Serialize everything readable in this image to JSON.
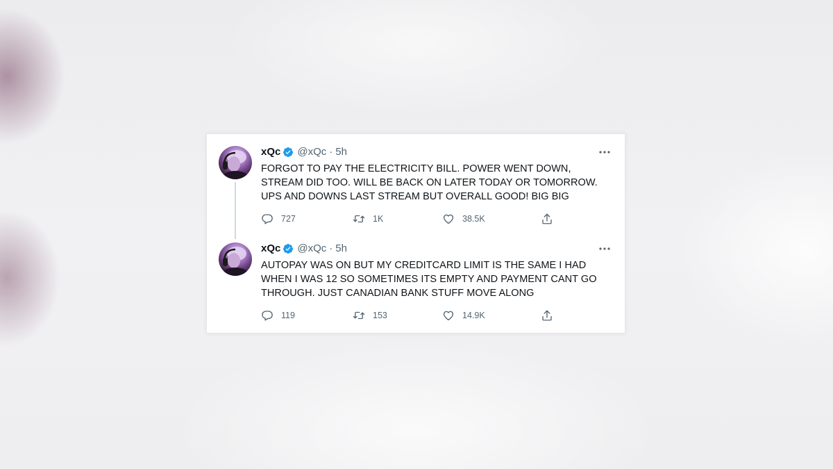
{
  "tweets": [
    {
      "author": {
        "display_name": "xQc",
        "handle": "@xQc",
        "verified": true,
        "avatar_icon": "avatar-icon"
      },
      "separator": "·",
      "time": "5h",
      "text": "FORGOT TO PAY THE ELECTRICITY BILL. POWER WENT DOWN, STREAM DID TOO. WILL BE BACK ON LATER TODAY OR TOMORROW. UPS AND DOWNS LAST STREAM BUT OVERALL GOOD! BIG BIG",
      "stats": {
        "replies": "727",
        "retweets": "1K",
        "likes": "38.5K"
      }
    },
    {
      "author": {
        "display_name": "xQc",
        "handle": "@xQc",
        "verified": true,
        "avatar_icon": "avatar-icon"
      },
      "separator": "·",
      "time": "5h",
      "text": "AUTOPAY WAS ON BUT MY CREDITCARD LIMIT IS THE SAME I HAD WHEN I WAS 12 SO SOMETIMES ITS EMPTY AND PAYMENT CANT GO THROUGH. JUST CANADIAN BANK STUFF MOVE ALONG",
      "stats": {
        "replies": "119",
        "retweets": "153",
        "likes": "14.9K"
      }
    }
  ],
  "icons": {
    "verified": "verified-badge-icon",
    "more": "more-options-icon",
    "reply": "reply-icon",
    "retweet": "retweet-icon",
    "like": "heart-icon",
    "share": "share-icon"
  },
  "colors": {
    "verified_blue": "#1d9bf0",
    "text_primary": "#0f1419",
    "text_secondary": "#536471",
    "thread_line": "#cfd9de"
  }
}
